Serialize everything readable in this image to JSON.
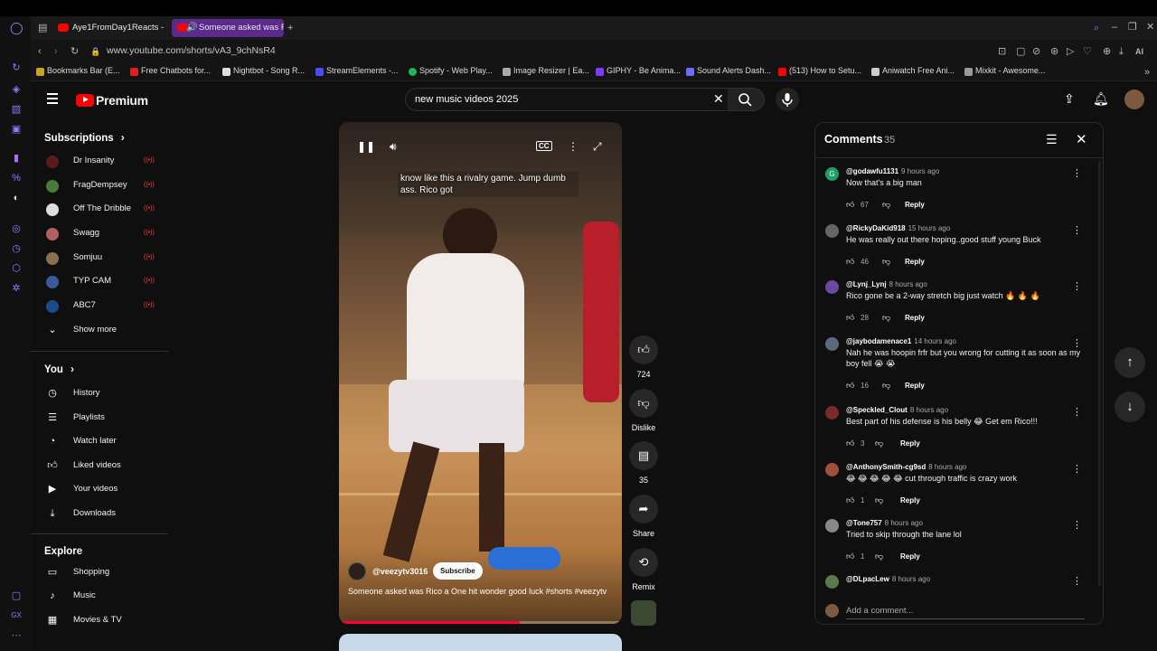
{
  "browser": {
    "tabs": [
      {
        "title": "Aye1FromDay1Reacts - Yo"
      },
      {
        "title": "Someone asked was R"
      }
    ],
    "url": "www.youtube.com/shorts/vA3_9chNsR4",
    "ai_label": "AI",
    "bookmarks": [
      "Bookmarks Bar (E...",
      "Free Chatbots for...",
      "Nightbot - Song R...",
      "StreamElements -...",
      "Spotify - Web Play...",
      "Image Resizer | Ea...",
      "GIPHY - Be Anima...",
      "Sound Alerts Dash...",
      "(513) How to Setu...",
      "Aniwatch Free Ani...",
      "Mixkit - Awesome..."
    ],
    "side_label": "GX"
  },
  "header": {
    "logo_text": "Premium",
    "search_value": "new music videos 2025"
  },
  "sidebar": {
    "subscriptions_title": "Subscriptions",
    "channels": [
      "Dr Insanity",
      "FragDempsey",
      "Off The Dribble",
      "Swagg",
      "Somjuu",
      "TYP CAM",
      "ABC7"
    ],
    "show_more": "Show more",
    "you_title": "You",
    "you_items": [
      "History",
      "Playlists",
      "Watch later",
      "Liked videos",
      "Your videos",
      "Downloads"
    ],
    "explore_title": "Explore",
    "explore_items": [
      "Shopping",
      "Music",
      "Movies & TV"
    ]
  },
  "video": {
    "caption": "know like this a rivalry game. Jump dumb ass. Rico got",
    "channel": "@veezytv3016",
    "subscribe": "Subscribe",
    "title": "Someone asked was Rico a One hit wonder good luck #shorts #veezytv",
    "progress": 0.64,
    "cc_label": "CC"
  },
  "actions": {
    "likes": "724",
    "dislike": "Dislike",
    "comments": "35",
    "share": "Share",
    "remix": "Remix"
  },
  "comments": {
    "title": "Comments",
    "count": "35",
    "reply_label": "Reply",
    "placeholder": "Add a comment...",
    "items": [
      {
        "user": "@godawfu1131",
        "time": "9 hours ago",
        "text": "Now that's a big man",
        "likes": "67",
        "avatar_letter": "G"
      },
      {
        "user": "@RickyDaKid918",
        "time": "15 hours ago",
        "text": "He was really out there hoping..good stuff young Buck",
        "likes": "46",
        "avatar_letter": ""
      },
      {
        "user": "@Lynj_Lynj",
        "time": "8 hours ago",
        "text": "Rico gone be a 2-way stretch big just watch 🔥 🔥 🔥",
        "likes": "28",
        "avatar_letter": ""
      },
      {
        "user": "@jaybodamenace1",
        "time": "14 hours ago",
        "text": "Nah he was hoopin frfr but you wrong for cutting it as soon as my boy fell 😭 😭",
        "likes": "16",
        "avatar_letter": ""
      },
      {
        "user": "@Speckled_Clout",
        "time": "8 hours ago",
        "text": "Best part of his defense is his belly 😂 Get em Rico!!!",
        "likes": "3",
        "avatar_letter": ""
      },
      {
        "user": "@AnthonySmith-cg9sd",
        "time": "8 hours ago",
        "text": "😂 😂 😂 😂 😂 cut through traffic is crazy work",
        "likes": "1",
        "avatar_letter": ""
      },
      {
        "user": "@Tone757",
        "time": "8 hours ago",
        "text": "Tried to skip through the lane lol",
        "likes": "1",
        "avatar_letter": ""
      },
      {
        "user": "@DLpacLew",
        "time": "8 hours ago",
        "text": "",
        "likes": "",
        "avatar_letter": ""
      }
    ]
  },
  "colors": {
    "accent": "#ff0000",
    "background": "#0f0f0f",
    "opera_accent": "#8a7cff"
  }
}
